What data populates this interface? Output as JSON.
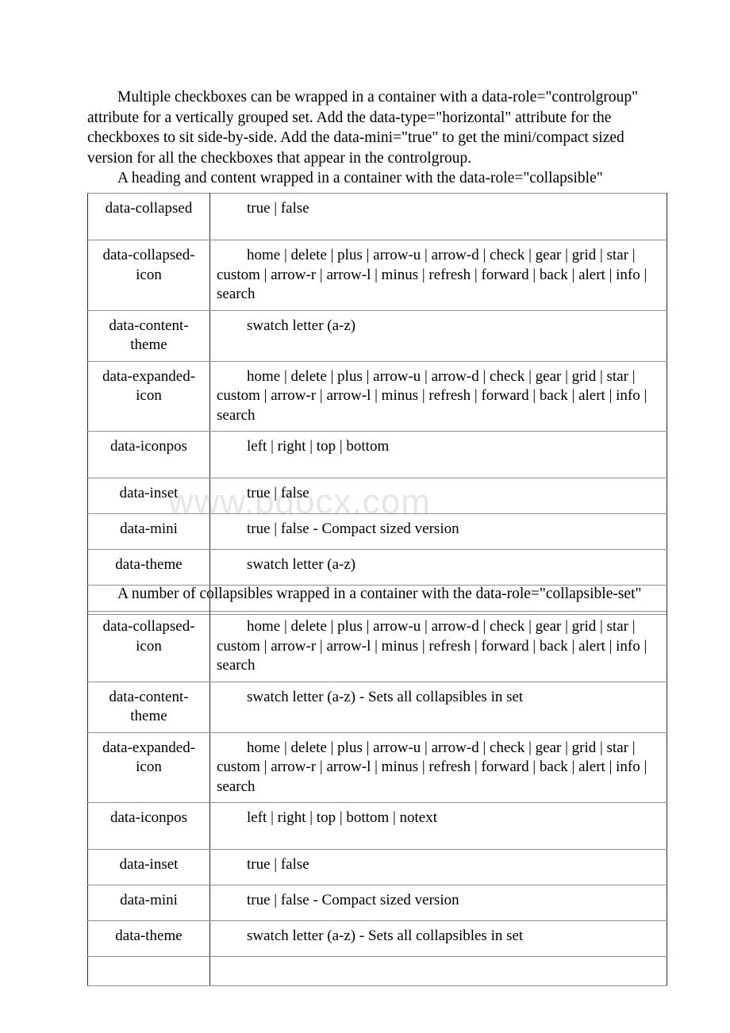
{
  "document": {
    "watermark": "www.bdocx.com",
    "intro_paragraph": "Multiple checkboxes can be wrapped in a container with a data-role=\"controlgroup\" attribute for a vertically grouped set. Add the data-type=\"horizontal\" attribute for the checkboxes to sit side-by-side. Add the data-mini=\"true\" to get the mini/compact sized version for all the checkboxes that appear in the controlgroup.",
    "heading_collapsible": "A heading and content wrapped in a container with the data-role=\"collapsible\"",
    "heading_collapsible_set": "A number of collapsibles wrapped in a container with the data-role=\"collapsible-set\"",
    "icon_values": "home | delete | plus | arrow-u | arrow-d | check | gear | grid | star | custom | arrow-r | arrow-l | minus | refresh | forward | back | alert | info | search",
    "tables": [
      {
        "id": "collapsible",
        "rows": [
          {
            "key": "data-collapsed",
            "value": "true | false"
          },
          {
            "key": "data-collapsed-icon",
            "value": "home | delete | plus | arrow-u | arrow-d | check | gear | grid | star | custom | arrow-r | arrow-l | minus | refresh | forward | back | alert | info | search"
          },
          {
            "key": "data-content-theme",
            "value": "swatch letter (a-z)"
          },
          {
            "key": "data-expanded-icon",
            "value": "home | delete | plus | arrow-u | arrow-d | check | gear | grid | star | custom | arrow-r | arrow-l | minus | refresh | forward | back | alert | info | search"
          },
          {
            "key": "data-iconpos",
            "value": "left | right | top | bottom"
          },
          {
            "key": "data-inset",
            "value": "true | false"
          },
          {
            "key": "data-mini",
            "value": "true | false - Compact sized version"
          },
          {
            "key": "data-theme",
            "value": "swatch letter (a-z)"
          },
          {
            "key": "",
            "value": ""
          }
        ]
      },
      {
        "id": "collapsible-set",
        "rows": [
          {
            "key": "data-collapsed-icon",
            "value": "home | delete | plus | arrow-u | arrow-d | check | gear | grid | star | custom | arrow-r | arrow-l | minus | refresh | forward | back | alert | info | search"
          },
          {
            "key": "data-content-theme",
            "value": "swatch letter (a-z) - Sets all collapsibles in set"
          },
          {
            "key": "data-expanded-icon",
            "value": "home | delete | plus | arrow-u | arrow-d | check | gear | grid | star | custom | arrow-r | arrow-l | minus | refresh | forward | back | alert | info | search"
          },
          {
            "key": "data-iconpos",
            "value": "left | right | top | bottom | notext"
          },
          {
            "key": "data-inset",
            "value": "true | false"
          },
          {
            "key": "data-mini",
            "value": "true | false - Compact sized version"
          },
          {
            "key": "data-theme",
            "value": "swatch letter (a-z) - Sets all collapsibles in set"
          },
          {
            "key": "",
            "value": ""
          }
        ]
      }
    ]
  }
}
